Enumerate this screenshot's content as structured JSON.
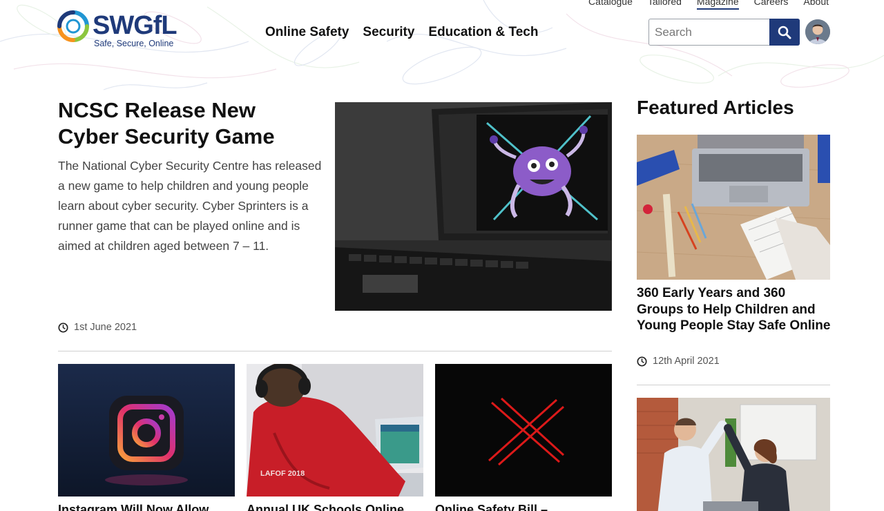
{
  "utility_nav": [
    "Catalogue",
    "Tailored",
    "Magazine",
    "Careers",
    "About"
  ],
  "utility_nav_active": "Magazine",
  "brand": {
    "name": "SWGfL",
    "tagline": "Safe, Secure, Online",
    "color": "#1f3a7a"
  },
  "main_nav": [
    "Online Safety",
    "Security",
    "Education & Tech"
  ],
  "search": {
    "placeholder": "Search",
    "button_icon": "search-icon"
  },
  "hero": {
    "title": "NCSC Release New Cyber Security Game",
    "summary": "The National Cyber Security Centre has released a new game to help children and young people learn about cyber security. Cyber Sprinters is a runner game that can be played online and is aimed at children aged between 7 – 11.",
    "date": "1st June 2021",
    "image": "laptop-virus-image"
  },
  "cards": [
    {
      "title": "Instagram Will Now Allow",
      "image": "instagram-logo-image"
    },
    {
      "title": "Annual UK Schools Online",
      "image": "child-headphones-laptop-image"
    },
    {
      "title": "Online Safety Bill –",
      "image": "red-x-image"
    }
  ],
  "featured": {
    "heading": "Featured Articles",
    "items": [
      {
        "title": "360 Early Years and 360 Groups to Help Children and Young People Stay Safe Online",
        "date": "12th April 2021",
        "image": "desk-laptop-notebook-image"
      },
      {
        "title": "",
        "image": "office-high-five-image"
      }
    ]
  }
}
